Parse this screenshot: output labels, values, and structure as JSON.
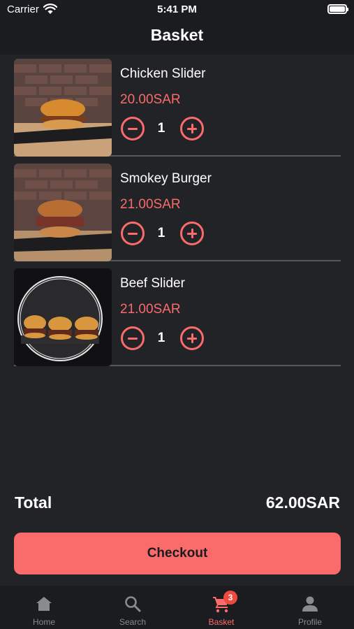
{
  "status_bar": {
    "carrier": "Carrier",
    "time": "5:41 PM"
  },
  "header": {
    "title": "Basket"
  },
  "items": [
    {
      "name": "Chicken Slider",
      "price": "20.00SAR",
      "quantity": "1",
      "image_icon": "chicken-slider-photo"
    },
    {
      "name": "Smokey Burger",
      "price": "21.00SAR",
      "quantity": "1",
      "image_icon": "smokey-burger-photo"
    },
    {
      "name": "Beef Slider",
      "price": "21.00SAR",
      "quantity": "1",
      "image_icon": "beef-slider-photo"
    }
  ],
  "summary": {
    "total_label": "Total",
    "total_value": "62.00SAR"
  },
  "checkout": {
    "label": "Checkout"
  },
  "tabbar": {
    "tabs": [
      {
        "label": "Home",
        "icon": "home-icon"
      },
      {
        "label": "Search",
        "icon": "search-icon"
      },
      {
        "label": "Basket",
        "icon": "cart-icon",
        "badge": "3",
        "active": true
      },
      {
        "label": "Profile",
        "icon": "person-icon"
      }
    ]
  },
  "colors": {
    "accent": "#fa6b6c",
    "background": "#222327",
    "bar": "#1b1c1f",
    "badge": "#f04a3f"
  }
}
